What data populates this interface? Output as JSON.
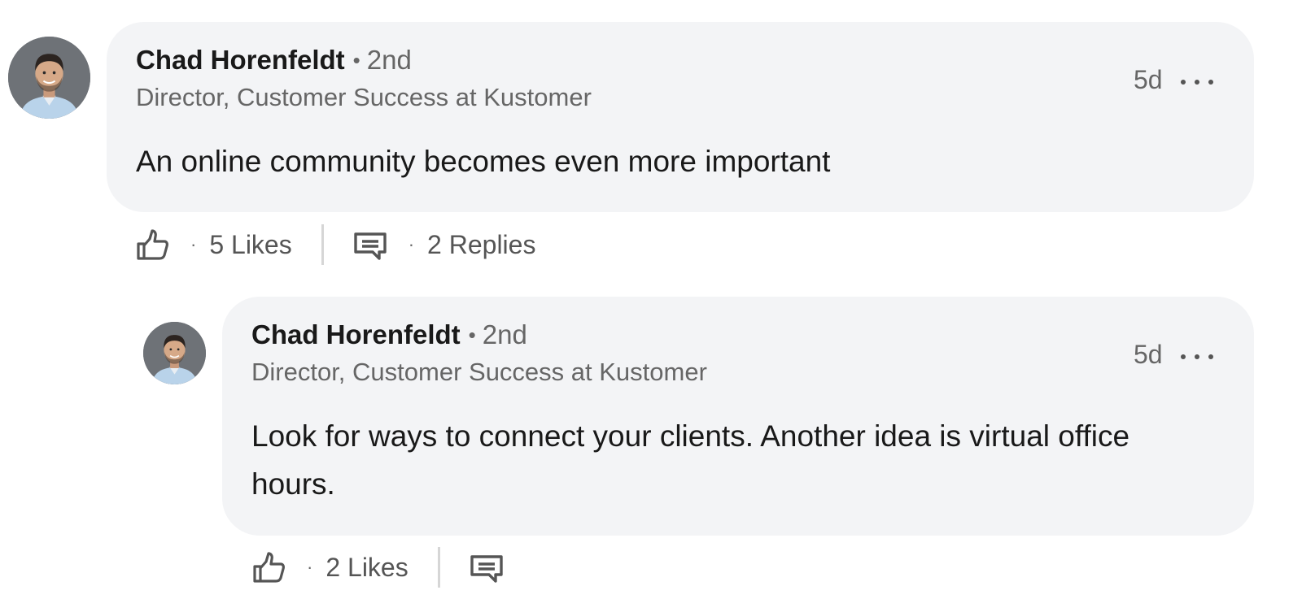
{
  "comments": [
    {
      "author": "Chad Horenfeldt",
      "degree": "2nd",
      "headline": "Director, Customer Success at Kustomer",
      "time": "5d",
      "text": "An online community becomes even more important",
      "likes_label": "5 Likes",
      "replies_label": "2 Replies",
      "avatar_icon": "avatar-photo"
    },
    {
      "author": "Chad Horenfeldt",
      "degree": "2nd",
      "headline": "Director, Customer Success at Kustomer",
      "time": "5d",
      "text": "Look for ways to connect your clients. Another idea is virtual office hours.",
      "likes_label": "2 Likes",
      "avatar_icon": "avatar-photo"
    }
  ],
  "icons": {
    "like": "thumbs-up-icon",
    "reply": "speech-bubble-icon",
    "more": "ellipsis-icon"
  },
  "colors": {
    "bubble_bg": "#f3f4f6",
    "secondary_text": "#666666",
    "primary_text": "#191919"
  }
}
